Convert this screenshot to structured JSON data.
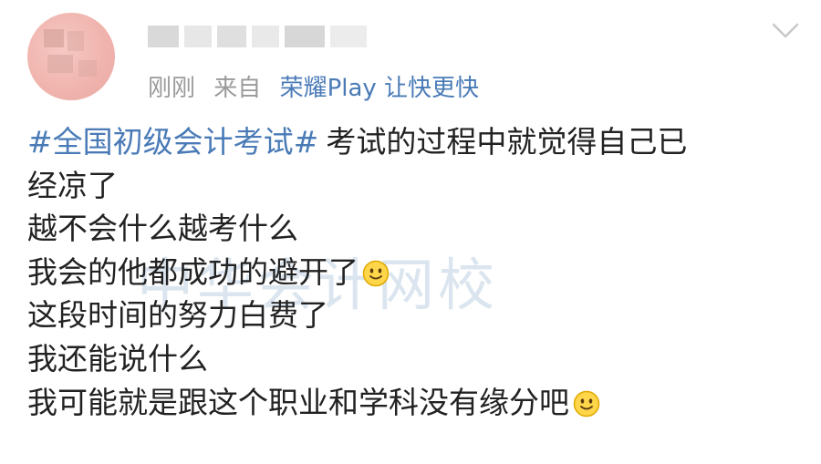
{
  "post": {
    "meta": {
      "time": "刚刚",
      "from_prefix": "来自",
      "source": "荣耀Play 让快更快"
    },
    "content": {
      "topic": "#全国初级会计考试#",
      "line1_rest": "考试的过程中就觉得自己已",
      "lines": [
        "经凉了",
        "越不会什么越考什么",
        "我会的他都成功的避开了",
        "这段时间的努力白费了",
        "我还能说什么",
        "我可能就是跟这个职业和学科没有缘分吧"
      ]
    }
  },
  "watermark": "中华会计网校",
  "icons": {
    "avatar": "blurred-avatar",
    "more": "chevron-down-icon",
    "emoji": "smile-emoji-icon"
  },
  "colors": {
    "link": "#4a7bb7",
    "meta": "#9a9a9a",
    "text": "#222222",
    "watermark": "#dbe5ef"
  }
}
